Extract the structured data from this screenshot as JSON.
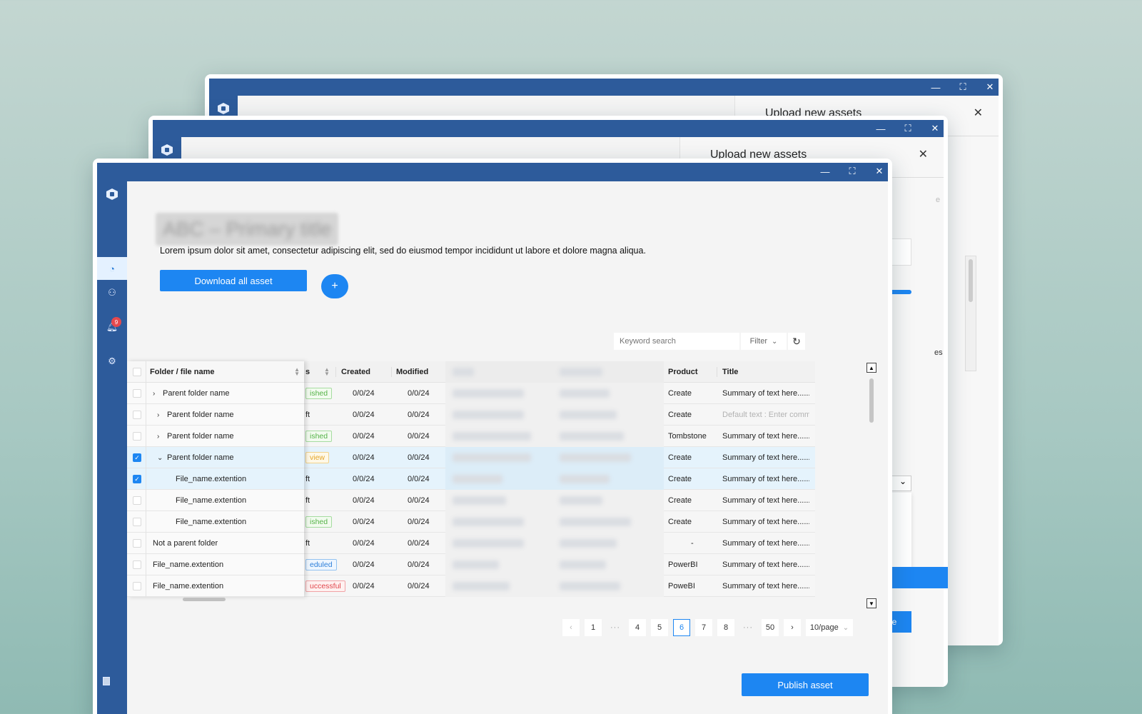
{
  "windows": {
    "controls": {
      "minimize": "—",
      "maximize": "⛶",
      "close": "✕"
    },
    "back_panel_title": "Upload new assets",
    "mid_panel_title": "Upload new assets",
    "panel_close": "✕",
    "mid_fragments": {
      "e": "e",
      "es": "es",
      "ue": "ue"
    }
  },
  "sidebar": {
    "expand_icon": "›",
    "notification_count": "9",
    "items": [
      "dashboard",
      "users",
      "notifications",
      "settings"
    ]
  },
  "page": {
    "title_blurred": "ABC – Primary title",
    "description": "Lorem ipsum dolor sit amet, consectetur adipiscing elit, sed do eiusmod tempor incididunt ut labore et dolore magna aliqua.",
    "download_button": "Download all asset",
    "add_button": "+",
    "search_placeholder": "Keyword search",
    "filter_label": "Filter",
    "filter_chevron": "⌄",
    "refresh_icon": "↻",
    "publish_button": "Publish asset"
  },
  "table": {
    "headers": {
      "name": "Folder / file name",
      "status": "s",
      "created": "Created",
      "modified": "Modified",
      "product": "Product",
      "title": "Title"
    },
    "rows": [
      {
        "name": "Parent folder name",
        "indent": 0,
        "chev": "›",
        "status": "ished",
        "status_color": "green",
        "created": "0/0/24",
        "modified": "0/0/24",
        "product": "Create",
        "title": "Summary of text here......",
        "checked": false
      },
      {
        "name": "Parent folder name",
        "indent": 1,
        "chev": "›",
        "status": "ft",
        "status_color": "",
        "created": "0/0/24",
        "modified": "0/0/24",
        "product": "Create",
        "title": "Default text  : Enter comm",
        "checked": false
      },
      {
        "name": "Parent folder name",
        "indent": 1,
        "chev": "›",
        "status": "ished",
        "status_color": "green",
        "created": "0/0/24",
        "modified": "0/0/24",
        "product": "Tombstone",
        "title": "Summary of text here......",
        "checked": false
      },
      {
        "name": "Parent folder name",
        "indent": 1,
        "chev": "⌄",
        "status": "view",
        "status_color": "orange",
        "created": "0/0/24",
        "modified": "0/0/24",
        "product": "Create",
        "title": "Summary of text here......",
        "checked": true
      },
      {
        "name": "File_name.extention",
        "indent": 2,
        "chev": "",
        "status": "ft",
        "status_color": "",
        "created": "0/0/24",
        "modified": "0/0/24",
        "product": "Create",
        "title": "Summary of text here......",
        "checked": true
      },
      {
        "name": "File_name.extention",
        "indent": 2,
        "chev": "",
        "status": "ft",
        "status_color": "",
        "created": "0/0/24",
        "modified": "0/0/24",
        "product": "Create",
        "title": "Summary of text here......",
        "checked": false
      },
      {
        "name": "File_name.extention",
        "indent": 2,
        "chev": "",
        "status": "ished",
        "status_color": "green",
        "created": "0/0/24",
        "modified": "0/0/24",
        "product": "Create",
        "title": "Summary of text here......",
        "checked": false
      },
      {
        "name": "Not a parent folder",
        "indent": 0,
        "chev": "",
        "status": "ft",
        "status_color": "",
        "created": "0/0/24",
        "modified": "0/0/24",
        "product": "-",
        "title": "Summary of text here......",
        "checked": false
      },
      {
        "name": "File_name.extention",
        "indent": 0,
        "chev": "",
        "status": "eduled",
        "status_color": "blue",
        "created": "0/0/24",
        "modified": "0/0/24",
        "product": "PowerBI",
        "title": "Summary of text here......",
        "checked": false
      },
      {
        "name": "File_name.extention",
        "indent": 0,
        "chev": "",
        "status": "uccessful",
        "status_color": "red",
        "created": "0/0/24",
        "modified": "0/0/24",
        "product": "PoweBI",
        "title": "Summary of text here......",
        "checked": false
      }
    ]
  },
  "pagination": {
    "prev": "‹",
    "pages": [
      "1",
      "···",
      "4",
      "5",
      "6",
      "7",
      "8",
      "···",
      "50"
    ],
    "current": "6",
    "next": "›",
    "page_size": "10/page",
    "page_size_chevron": "⌄"
  },
  "colors": {
    "brand": "#2d5b9b",
    "accent": "#1d86f2"
  }
}
